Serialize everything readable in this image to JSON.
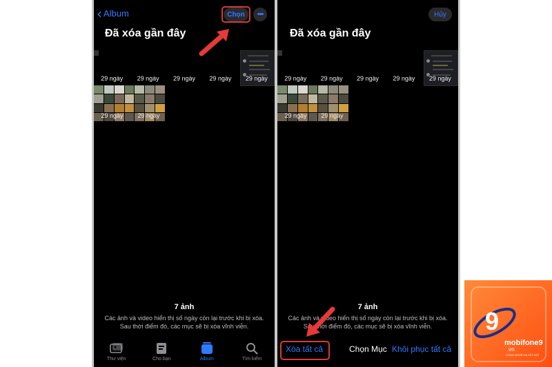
{
  "left_screen": {
    "back_label": "Album",
    "select_button": "Chọn",
    "more_button": "•••",
    "title": "Đã xóa gần đây",
    "days_row1": [
      "29 ngày",
      "29 ngày",
      "29 ngày",
      "29 ngày",
      "29 ngày"
    ],
    "days_row2": [
      "29 ngày",
      "29 ngày"
    ],
    "count": "7 ảnh",
    "note_line1": "Các ảnh và video hiển thị số ngày còn lại trước khi bị xóa.",
    "note_line2": "Sau thời điểm đó, các mục sẽ bị xóa vĩnh viễn.",
    "tabs": [
      {
        "label": "Thư viện",
        "icon": "photo-library-icon"
      },
      {
        "label": "Cho bạn",
        "icon": "for-you-icon"
      },
      {
        "label": "Album",
        "icon": "album-icon"
      },
      {
        "label": "Tìm kiếm",
        "icon": "search-icon"
      }
    ],
    "active_tab": "Album"
  },
  "right_screen": {
    "cancel_button": "Hủy",
    "title": "Đã xóa gần đây",
    "days_row1": [
      "29 ngày",
      "29 ngày",
      "29 ngày",
      "29 ngày",
      "29 ngày"
    ],
    "days_row2": [
      "29 ngày",
      "29 ngày"
    ],
    "count": "7 ảnh",
    "note_line1": "Các ảnh và video hiển thị số ngày còn lại trước khi bị xóa.",
    "note_line2": "Sau thời điểm đó, các mục sẽ bị xóa vĩnh viễn.",
    "delete_all": "Xóa tất cả",
    "choose_items": "Chọn Mục",
    "recover_all": "Khôi phục tất cả"
  },
  "watermark": {
    "brand": "mobifone9",
    "domain": ".vn",
    "tagline": "CÔNG NGHỆ VÀ KẾT NỐI"
  },
  "colors": {
    "accent": "#2f7bff",
    "highlight": "#d93a3a",
    "arrow": "#e8393a",
    "logo_bg": "#ff6a1f"
  }
}
